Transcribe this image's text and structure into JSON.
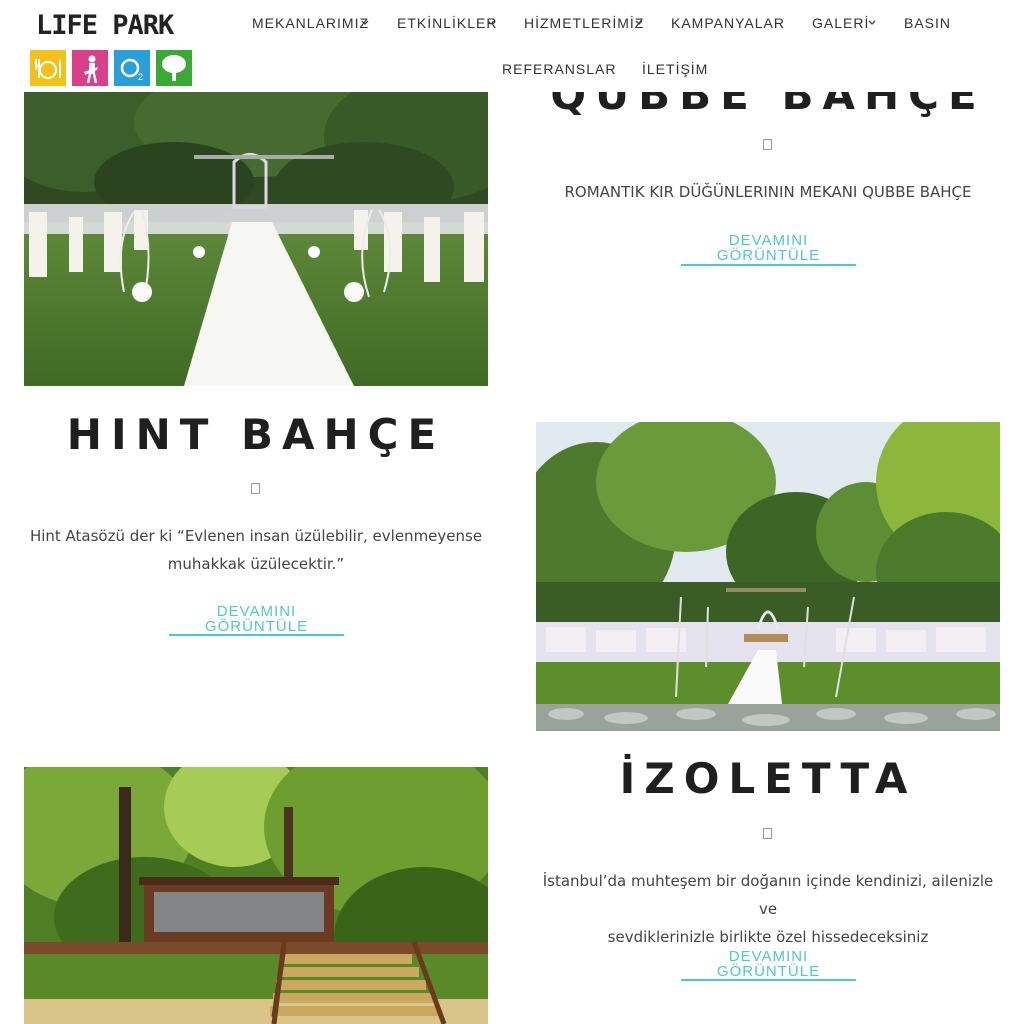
{
  "logo": {
    "text": "LIFE PARK",
    "o2": "O2"
  },
  "nav": {
    "row1": [
      {
        "label": "MEKANLARIMIZ",
        "dropdown": true
      },
      {
        "label": "ETKİNLİKLER",
        "dropdown": true
      },
      {
        "label": "HİZMETLERİMİZ",
        "dropdown": true
      },
      {
        "label": "KAMPANYALAR",
        "dropdown": false
      },
      {
        "label": "GALERİ",
        "dropdown": true
      },
      {
        "label": "BASIN",
        "dropdown": false
      }
    ],
    "row2": [
      {
        "label": "REFERANSLAR"
      },
      {
        "label": "İLETİŞİM"
      }
    ]
  },
  "venues": [
    {
      "title": "QUBBE BAHÇE",
      "description": "ROMANTIK KIR DÜĞÜNLERININ MEKANI QUBBE BAHÇE",
      "more_line1": "DEVAMINI",
      "more_line2": "GÖRÜNTÜLE"
    },
    {
      "title": "HINT BAHÇE",
      "description_line1": "Hint Atasözü der ki “Evlenen insan üzülebilir, evlenmeyense",
      "description_line2": "muhakkak üzülecektir.”",
      "more_line1": "DEVAMINI",
      "more_line2": "GÖRÜNTÜLE"
    },
    {
      "title": "İZOLETTA",
      "description_line1": "İstanbul’da muhteşem bir doğanın içinde kendinizi, ailenizle ve",
      "description_line2": "sevdiklerinizle birlikte özel hissedeceksiniz",
      "more_line1": "DEVAMINI",
      "more_line2": "GÖRÜNTÜLE"
    }
  ],
  "colors": {
    "accent": "#4fc6d3",
    "title": "#1f1f1f",
    "tile_yellow": "#f2c21b",
    "tile_pink": "#d8408a",
    "tile_blue": "#2a9fd8",
    "tile_green": "#3aa935"
  }
}
